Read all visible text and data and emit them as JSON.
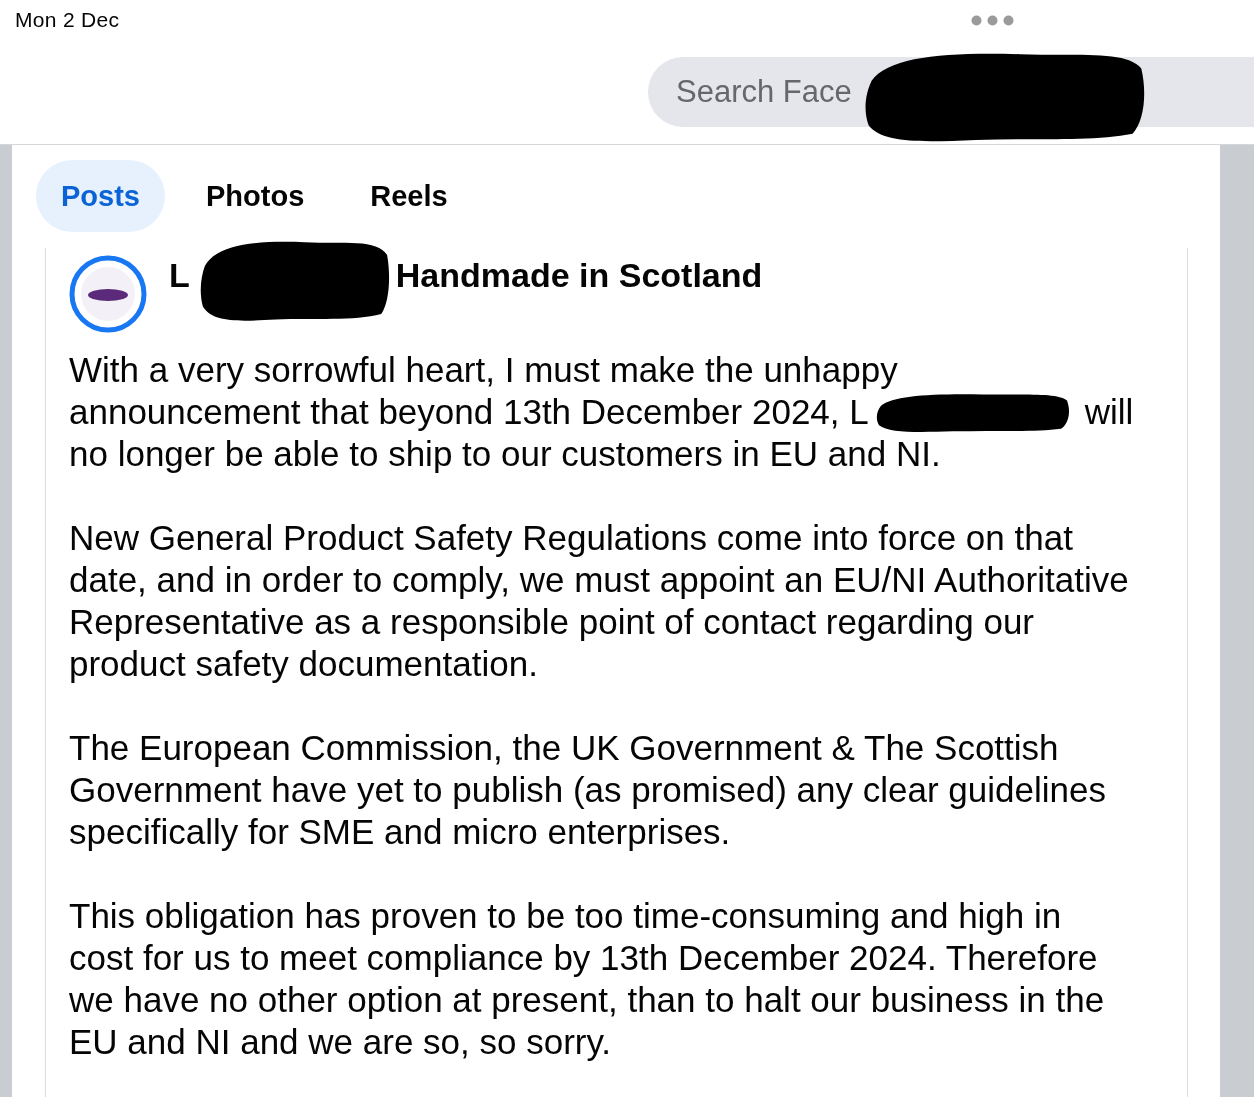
{
  "status_bar": {
    "date": "Mon 2 Dec"
  },
  "search": {
    "placeholder": "Search Face"
  },
  "tabs": [
    {
      "label": "Posts",
      "selected": true
    },
    {
      "label": "Photos",
      "selected": false
    },
    {
      "label": "Reels",
      "selected": false
    }
  ],
  "post": {
    "author": {
      "name_start": "L",
      "name_end": "Handmade in Scotland"
    },
    "paragraphs": [
      {
        "kind": "redacted",
        "lines": [
          [
            "With a very sorrowful heart, I must make the unhappy"
          ],
          [
            "announcement that beyond 13th December 2024, L",
            "will"
          ],
          [
            "no longer be able to ship to our customers in EU and NI."
          ]
        ]
      },
      {
        "kind": "plain",
        "lines": [
          "New General Product Safety Regulations come into force on that",
          "date, and in order to comply, we must appoint an EU/NI Authoritative",
          "Representative as a responsible point of contact regarding our",
          "product safety documentation."
        ]
      },
      {
        "kind": "plain",
        "lines": [
          "The European Commission, the UK Government & The Scottish",
          "Government have yet to publish (as promised) any clear guidelines",
          "specifically for SME and micro enterprises."
        ]
      },
      {
        "kind": "plain",
        "lines": [
          "This obligation has proven to be too time-consuming and high in",
          "cost for us to meet compliance by 13th December 2024. Therefore",
          "we have no other option at present, than to halt our business in the",
          "EU and NI and we are so, so sorry."
        ]
      }
    ]
  }
}
